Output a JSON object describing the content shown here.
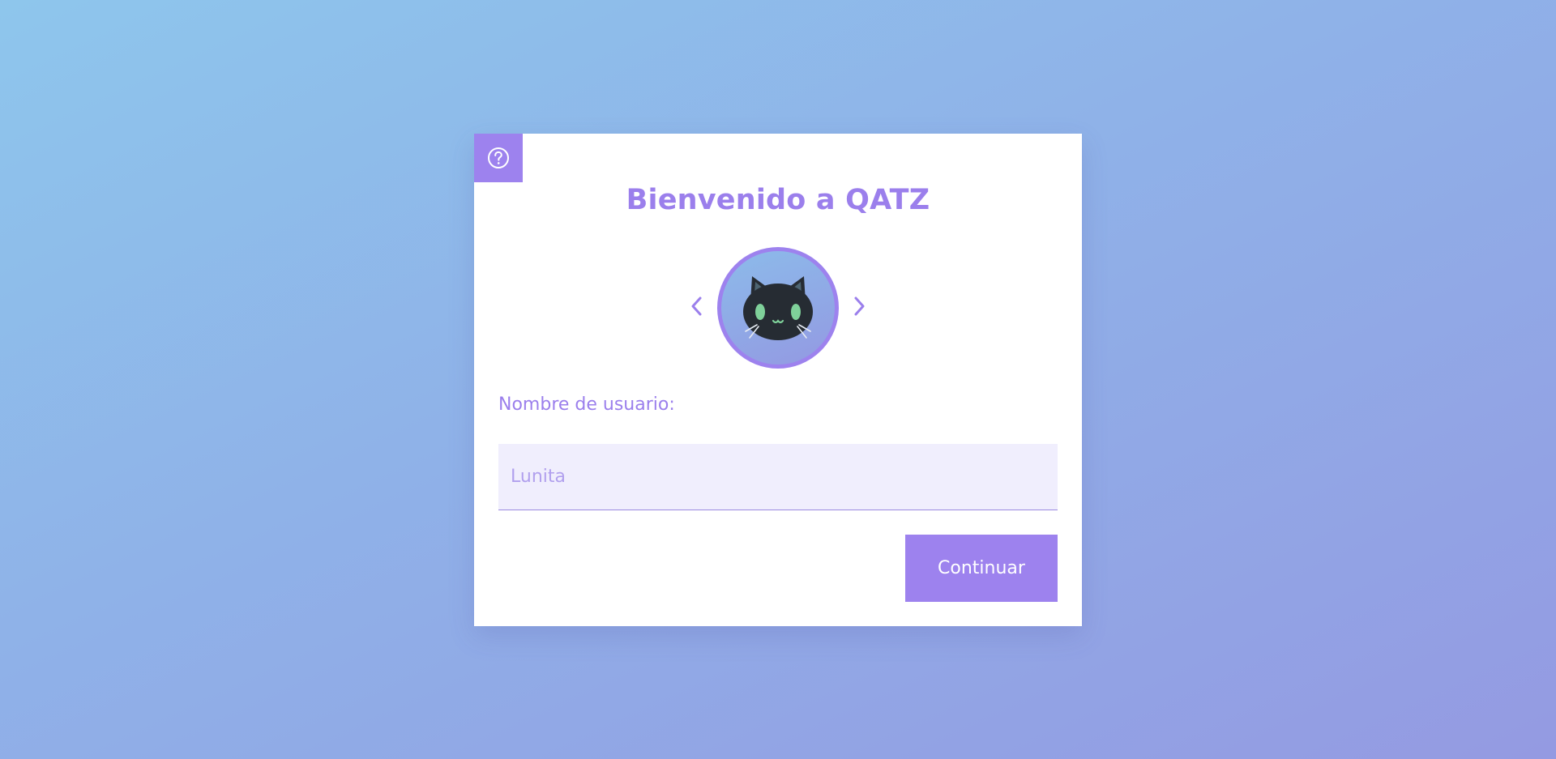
{
  "app": {
    "title": "Bienvenido a QATZ"
  },
  "help": {
    "icon": "question-circle-icon"
  },
  "avatar_picker": {
    "prev_icon": "chevron-left-icon",
    "next_icon": "chevron-right-icon",
    "avatar_icon": "black-cat-icon"
  },
  "form": {
    "username_label": "Nombre de usuario:",
    "username_placeholder": "Lunita",
    "username_value": "",
    "continue_label": "Continuar"
  },
  "colors": {
    "accent": "#9d82ee",
    "title": "#9b7fec",
    "input_bg": "#f0eefd",
    "card_bg": "#ffffff"
  }
}
